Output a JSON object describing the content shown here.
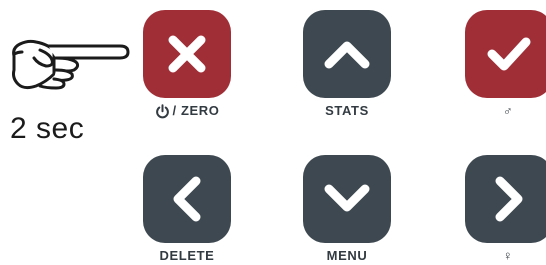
{
  "instruction": {
    "hand_icon": "pointing-hand-icon",
    "hold_time": "2 sec"
  },
  "keys": {
    "top_left": {
      "icon": "close-icon",
      "color": "#a02e37",
      "label": "/ ZERO",
      "label_icon": "power-icon"
    },
    "top_middle": {
      "icon": "chevron-up-icon",
      "color": "#3d4850",
      "label": "STATS"
    },
    "top_right": {
      "icon": "checkmark-icon",
      "color": "#a02e37",
      "label": "♂"
    },
    "bottom_left": {
      "icon": "chevron-left-icon",
      "color": "#3d4850",
      "label": "DELETE"
    },
    "bottom_middle": {
      "icon": "chevron-down-icon",
      "color": "#3d4850",
      "label": "MENU"
    },
    "bottom_right": {
      "icon": "chevron-right-icon",
      "color": "#3d4850",
      "label": "♀"
    }
  }
}
